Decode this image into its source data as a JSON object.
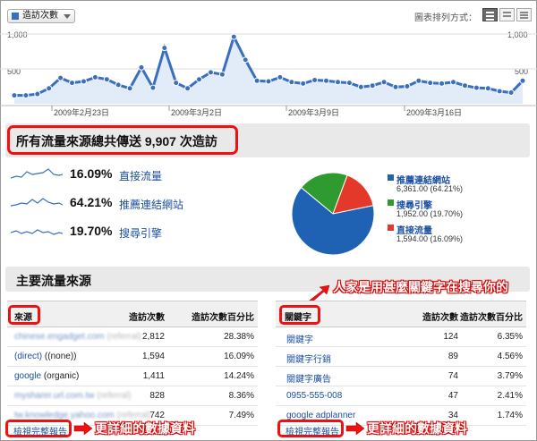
{
  "toolbar": {
    "metric_label": "造訪次數",
    "graph_mode_label": "圖表排列方式："
  },
  "graph": {
    "y_ticks": [
      "1,000",
      "500"
    ],
    "y_ticks_right": [
      "1,000",
      "500"
    ],
    "x_ticks": [
      "2009年2月23日",
      "2009年3月2日",
      "2009年3月9日",
      "2009年3月16日"
    ],
    "color": "#3a6fbf"
  },
  "chart_data": {
    "type": "area",
    "title": "",
    "series": [
      {
        "values": [
          120,
          120,
          140,
          220,
          370,
          300,
          320,
          380,
          350,
          270,
          220,
          520,
          230,
          800,
          300,
          220,
          350,
          450,
          420,
          960,
          630,
          330,
          320,
          380,
          310,
          290,
          340,
          330,
          310,
          300,
          240,
          260,
          310,
          240,
          250,
          330,
          300,
          290,
          310,
          260,
          230,
          220,
          180,
          160,
          330
        ]
      }
    ],
    "ylim": [
      0,
      1000
    ],
    "x_ticks": [
      "2009年2月23日",
      "2009年3月2日",
      "2009年3月9日",
      "2009年3月16日"
    ]
  },
  "summary": {
    "text": "所有流量來源總共傳送 9,907 次造訪"
  },
  "sources": [
    {
      "pct": "16.09%",
      "name": "直接流量"
    },
    {
      "pct": "64.21%",
      "name": "推薦連結網站"
    },
    {
      "pct": "19.70%",
      "name": "搜尋引擎"
    }
  ],
  "pie": {
    "slices": [
      {
        "name": "推薦連結網站",
        "value_text": "6,361.00 (64.21%)",
        "percent": 64.21,
        "color": "#1f62b3"
      },
      {
        "name": "搜尋引擎",
        "value_text": "1,952.00 (19.70%)",
        "percent": 19.7,
        "color": "#2f9a2f"
      },
      {
        "name": "直接流量",
        "value_text": "1,594.00 (16.09%)",
        "percent": 16.09,
        "color": "#e4392a"
      }
    ]
  },
  "main_sources": {
    "title": "主要流量來源"
  },
  "sources_table": {
    "headers": [
      "來源",
      "造訪次數",
      "造訪次數百分比"
    ],
    "rows": [
      {
        "name": "chinese.engadget.com",
        "suffix": "(referral)",
        "blurred": true,
        "visits": "2,812",
        "pct": "28.38%"
      },
      {
        "name": "(direct)",
        "suffix": "((none))",
        "blurred": false,
        "visits": "1,594",
        "pct": "16.09%"
      },
      {
        "name": "google",
        "suffix": "(organic)",
        "blurred": false,
        "visits": "1,411",
        "pct": "14.24%"
      },
      {
        "name": "mysharer.url.com.tw",
        "suffix": "(referral)",
        "blurred": true,
        "visits": "828",
        "pct": "8.36%"
      },
      {
        "name": "tw.knowledge.yahoo.com",
        "suffix": "(referral)",
        "blurred": true,
        "visits": "742",
        "pct": "7.49%"
      }
    ],
    "full_report": "檢視完整報告"
  },
  "keywords_table": {
    "headers": [
      "關鍵字",
      "造訪次數",
      "造訪次數百分比"
    ],
    "rows": [
      {
        "name": "關鍵字",
        "visits": "124",
        "pct": "6.35%"
      },
      {
        "name": "關鍵字行銷",
        "visits": "89",
        "pct": "4.56%"
      },
      {
        "name": "關鍵字廣告",
        "visits": "74",
        "pct": "3.79%"
      },
      {
        "name": "0955-555-008",
        "visits": "47",
        "pct": "2.41%"
      },
      {
        "name": "google adplanner",
        "visits": "34",
        "pct": "1.74%"
      }
    ],
    "full_report": "檢視完整報告"
  },
  "annotations": {
    "keywords": "人家是用甚麼關鍵字在搜尋你的",
    "details_left": "更詳細的數據資料",
    "details_right": "更詳細的數據資料"
  },
  "colors": {
    "highlight": "#ee1111",
    "link": "#1a4fa0"
  }
}
